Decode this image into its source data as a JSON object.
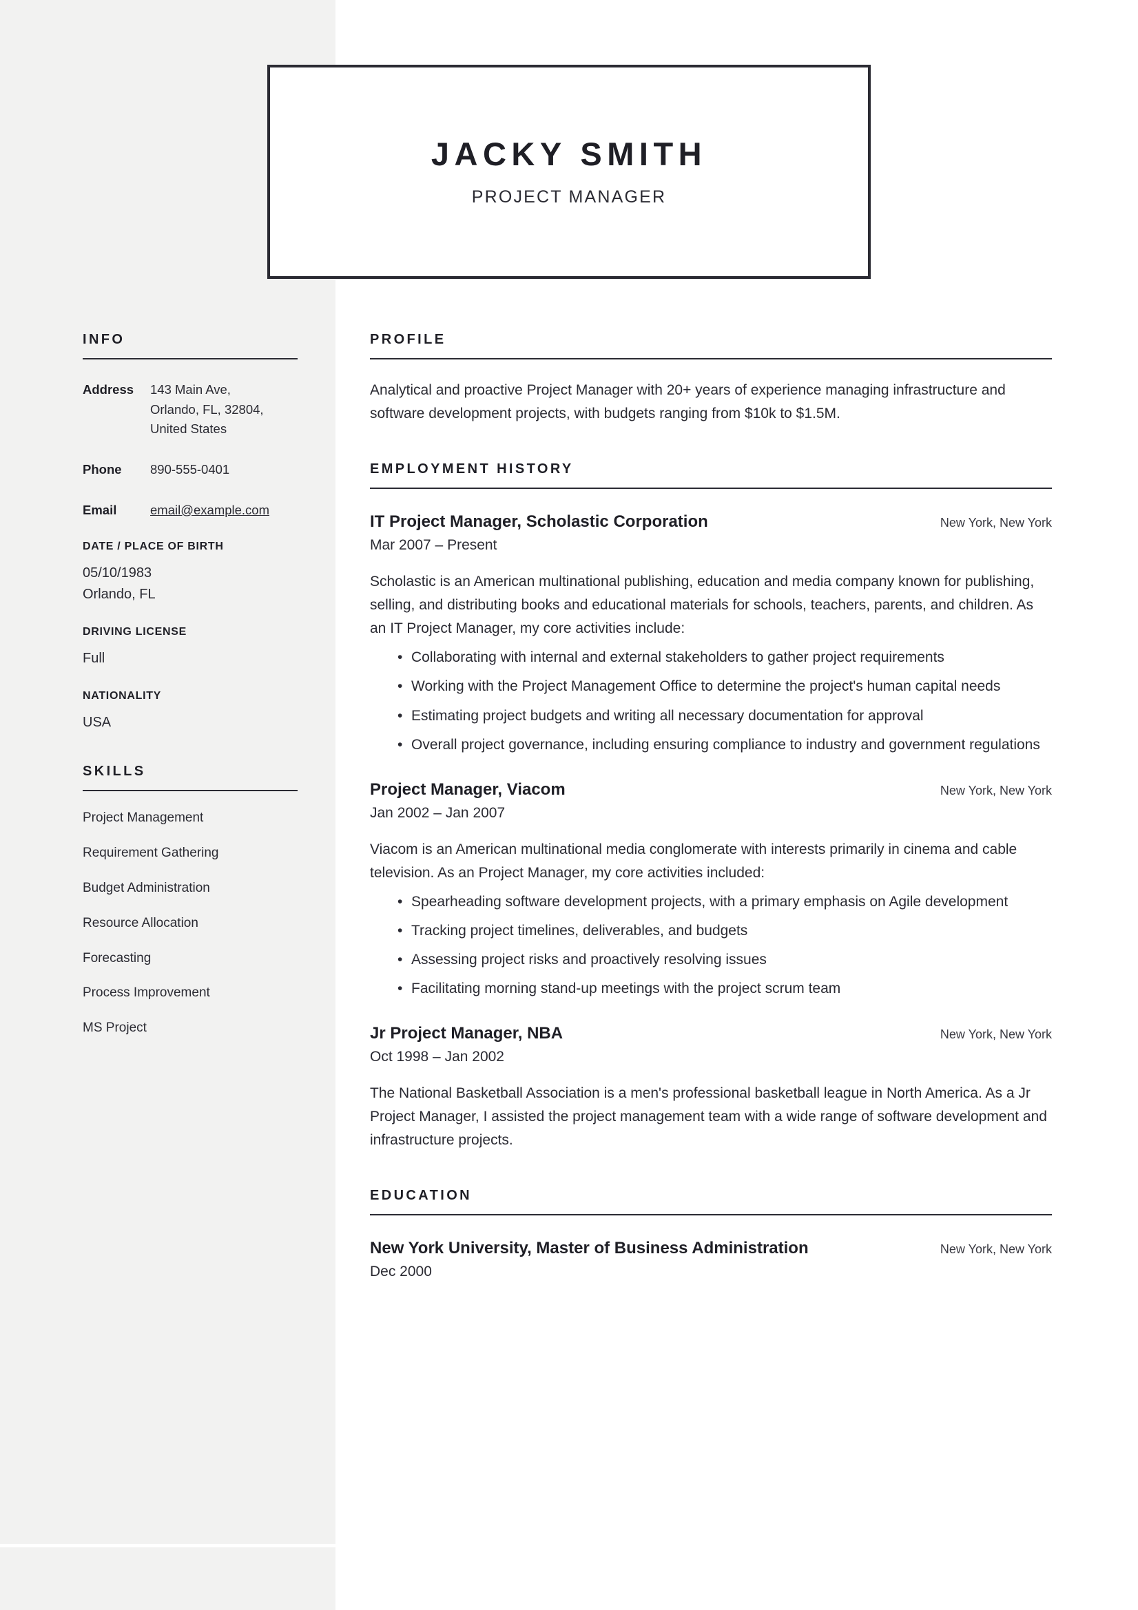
{
  "header": {
    "name": "JACKY SMITH",
    "job_title": "PROJECT MANAGER"
  },
  "sidebar": {
    "info": {
      "heading": "INFO",
      "rows": [
        {
          "label": "Address",
          "value": "143 Main Ave,\nOrlando, FL, 32804,\nUnited States"
        },
        {
          "label": "Phone",
          "value": "890-555-0401"
        },
        {
          "label": "Email",
          "value": "email@example.com"
        }
      ],
      "blocks": [
        {
          "heading": "DATE / PLACE OF BIRTH",
          "value": "05/10/1983\nOrlando, FL"
        },
        {
          "heading": "DRIVING LICENSE",
          "value": "Full"
        },
        {
          "heading": "NATIONALITY",
          "value": "USA"
        }
      ]
    },
    "skills": {
      "heading": "SKILLS",
      "items": [
        "Project Management",
        "Requirement Gathering",
        "Budget Administration",
        "Resource Allocation",
        "Forecasting",
        "Process Improvement",
        "MS Project"
      ]
    }
  },
  "main": {
    "profile": {
      "heading": "PROFILE",
      "text": "Analytical and proactive Project Manager with 20+ years of experience managing infrastructure and software development projects, with budgets ranging from $10k to $1.5M."
    },
    "employment": {
      "heading": "EMPLOYMENT HISTORY",
      "entries": [
        {
          "title": "IT Project Manager, Scholastic Corporation",
          "location": "New York, New York",
          "dates": "Mar 2007 – Present",
          "description": "Scholastic is an American multinational publishing, education and media company known for publishing, selling, and distributing books and educational materials for schools, teachers, parents, and children. As an IT Project Manager, my core activities include:",
          "bullets": [
            "Collaborating with internal and external stakeholders to gather project requirements",
            "Working with the Project Management Office to determine the project's human capital needs",
            "Estimating project budgets and writing all necessary documentation for approval",
            "Overall project governance, including ensuring compliance to industry and government regulations"
          ]
        },
        {
          "title": "Project Manager, Viacom",
          "location": "New York, New York",
          "dates": "Jan 2002 – Jan 2007",
          "description": "Viacom is an American multinational media conglomerate with interests primarily in cinema and cable television. As an Project Manager, my core activities included:",
          "bullets": [
            "Spearheading software development projects, with a primary emphasis on Agile development",
            "Tracking project timelines, deliverables, and budgets",
            "Assessing project risks and proactively resolving issues",
            "Facilitating morning stand-up meetings with the project scrum team"
          ]
        },
        {
          "title": "Jr Project Manager, NBA",
          "location": "New York, New York",
          "dates": "Oct 1998 – Jan 2002",
          "description": "The National Basketball Association is a men's professional basketball league in North America. As a Jr Project Manager, I assisted the project management team with a wide range of software development and infrastructure projects.",
          "bullets": []
        }
      ]
    },
    "education": {
      "heading": "EDUCATION",
      "entries": [
        {
          "title": "New York University, Master of Business Administration",
          "location": "New York, New York",
          "dates": "Dec 2000"
        }
      ]
    }
  },
  "colors": {
    "sidebar_background": "#f2f2f1",
    "page_background": "#ffffff",
    "text": "#2b2b33",
    "heading": "#1f1f26",
    "rule": "#2b2b33"
  }
}
